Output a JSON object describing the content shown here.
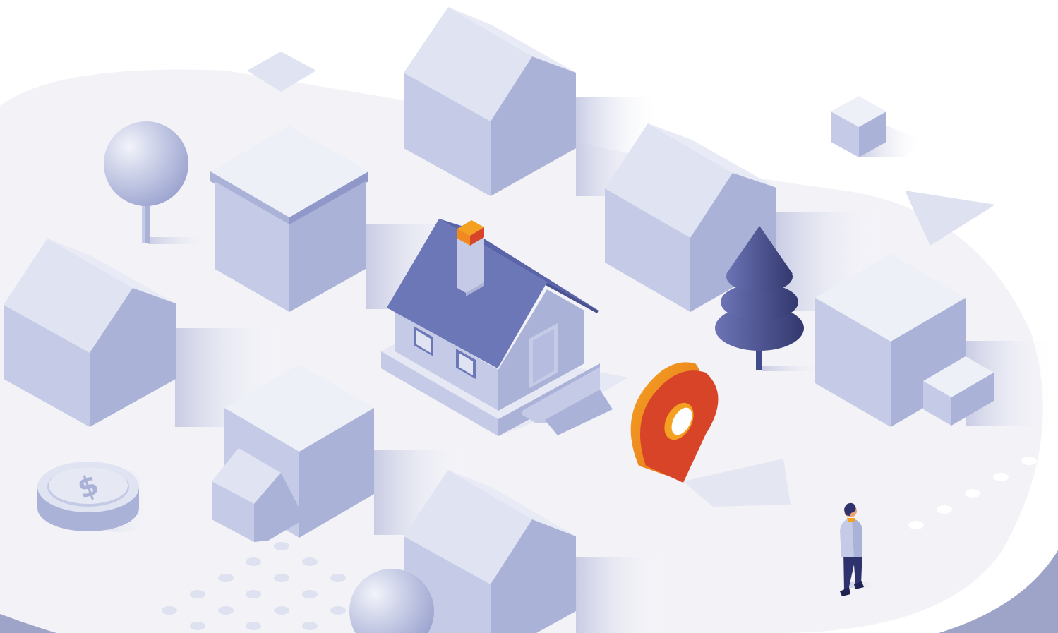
{
  "scene": {
    "palette": {
      "ground": "#f1f1f6",
      "ground_edge": "#e6e7f0",
      "frame": "#9ea3c8",
      "block_top": "#eef0f8",
      "block_left": "#c5cbe6",
      "block_right": "#aab2d8",
      "roof_light": "#dfe3f2",
      "roof_dark": "#6c77b8",
      "tree_dark": "#434a8c",
      "pin_orange": "#f4a020",
      "pin_red": "#d84428",
      "dots": "#dde1f0"
    },
    "icons": {
      "location": "map-pin-icon",
      "money": "dollar-coin-icon",
      "person": "person-icon",
      "home": "house-icon"
    }
  }
}
